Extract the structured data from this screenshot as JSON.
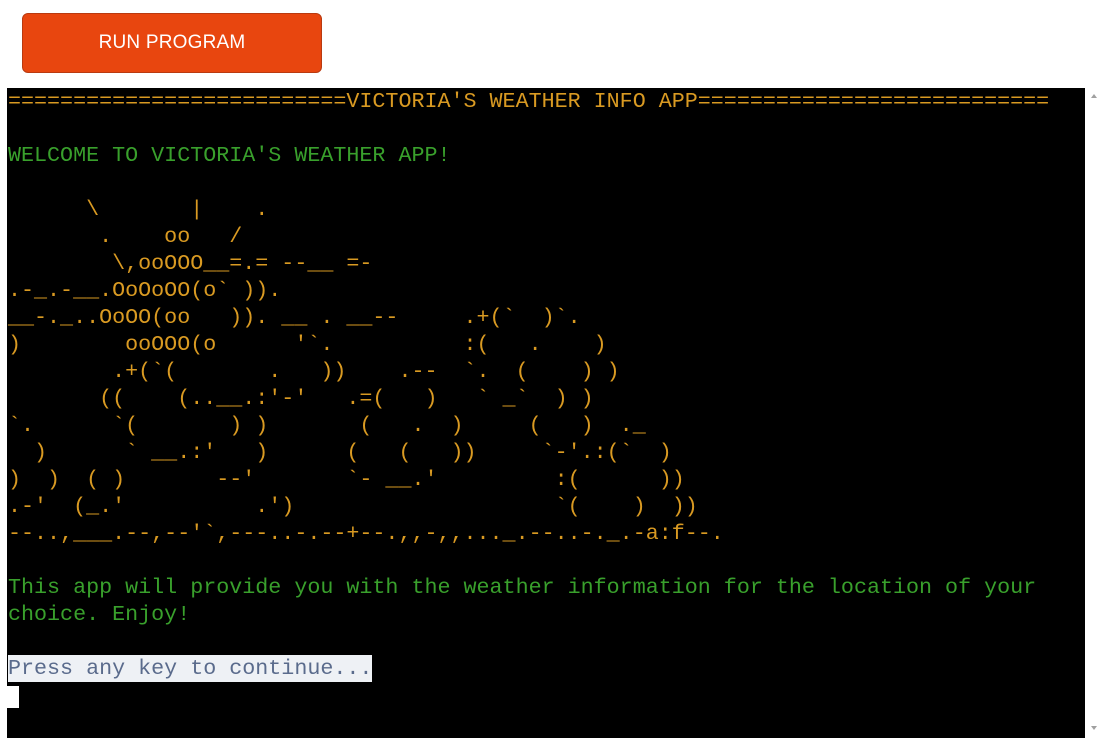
{
  "run_button": {
    "label": "RUN PROGRAM"
  },
  "terminal": {
    "title_line": "==========================VICTORIA'S WEATHER INFO APP===========================",
    "welcome": "WELCOME TO VICTORIA'S WEATHER APP!",
    "ascii_art": [
      "      \\       |    .",
      "       .    oo   /",
      "        \\,ooOOO__=.= --__ =-",
      ".-_.-__.OoOoOO(o` )).",
      "__-._..OoOO(oo   )). __ . __--     .+(`  )`.",
      ")        ooOOO(o      '`.          :(   .    )",
      "        .+(`(       .   ))    .--  `.  (    ) )",
      "       ((    (..__.:'-'   .=(   )   ` _`  ) )",
      "`.      `(       ) )       (   .  )     (   )  ._",
      "  )      ` __.:'   )      (   (   ))     `-'.:(`  )",
      ")  )  ( )       --'       `- __.'         :(      ))",
      ".-'  (_.'          .')                    `(    )  ))",
      "--..,___.--,--'`,---..-.--+--.,,-,,..._.--..-._.-a:f--."
    ],
    "description_lines": [
      "This app will provide you with the weather information for the location of your",
      "choice. Enjoy!"
    ],
    "prompt": "Press any key to continue..."
  },
  "colors": {
    "button": "#e8460f",
    "orange_text": "#d99a22",
    "green_text": "#39a02c",
    "terminal_bg": "#000000"
  }
}
